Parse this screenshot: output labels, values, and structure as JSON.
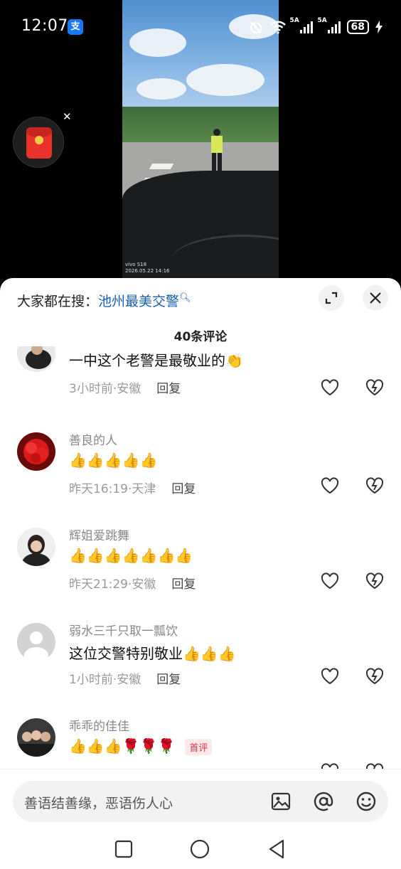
{
  "status_bar": {
    "time": "12:07",
    "app_badge": "支",
    "signal1_label": "5A",
    "signal2_label": "5A",
    "battery": "68"
  },
  "video": {
    "watermark_model": "vivo S18",
    "watermark_time": "2026.05.22 14:16"
  },
  "sheet": {
    "search_prefix": "大家都在搜：",
    "search_keyword": "池州最美交警",
    "comment_count": "40条评论"
  },
  "comments": [
    {
      "user": "",
      "text": "一中这个老警是最敬业的👏",
      "time_loc": "3小时前·安徽",
      "reply": "回复"
    },
    {
      "user": "善良的人",
      "text": "👍👍👍👍👍",
      "time_loc": "昨天16:19·天津",
      "reply": "回复"
    },
    {
      "user": "辉姐爱跳舞",
      "text": "👍👍👍👍👍👍👍",
      "time_loc": "昨天21:29·安徽",
      "reply": "回复"
    },
    {
      "user": "弱水三千只取一瓢饮",
      "text": "这位交警特别敬业👍👍👍",
      "time_loc": "1小时前·安徽",
      "reply": "回复"
    },
    {
      "user": "乖乖的佳佳",
      "text": "👍👍👍🌹🌹🌹",
      "time_loc": "",
      "reply": "",
      "badge": "首评"
    }
  ],
  "input": {
    "placeholder": "善语结善缘，恶语伤人心"
  },
  "colors": {
    "accent_link": "#1a5fb4",
    "first_badge": "#e0334b"
  }
}
